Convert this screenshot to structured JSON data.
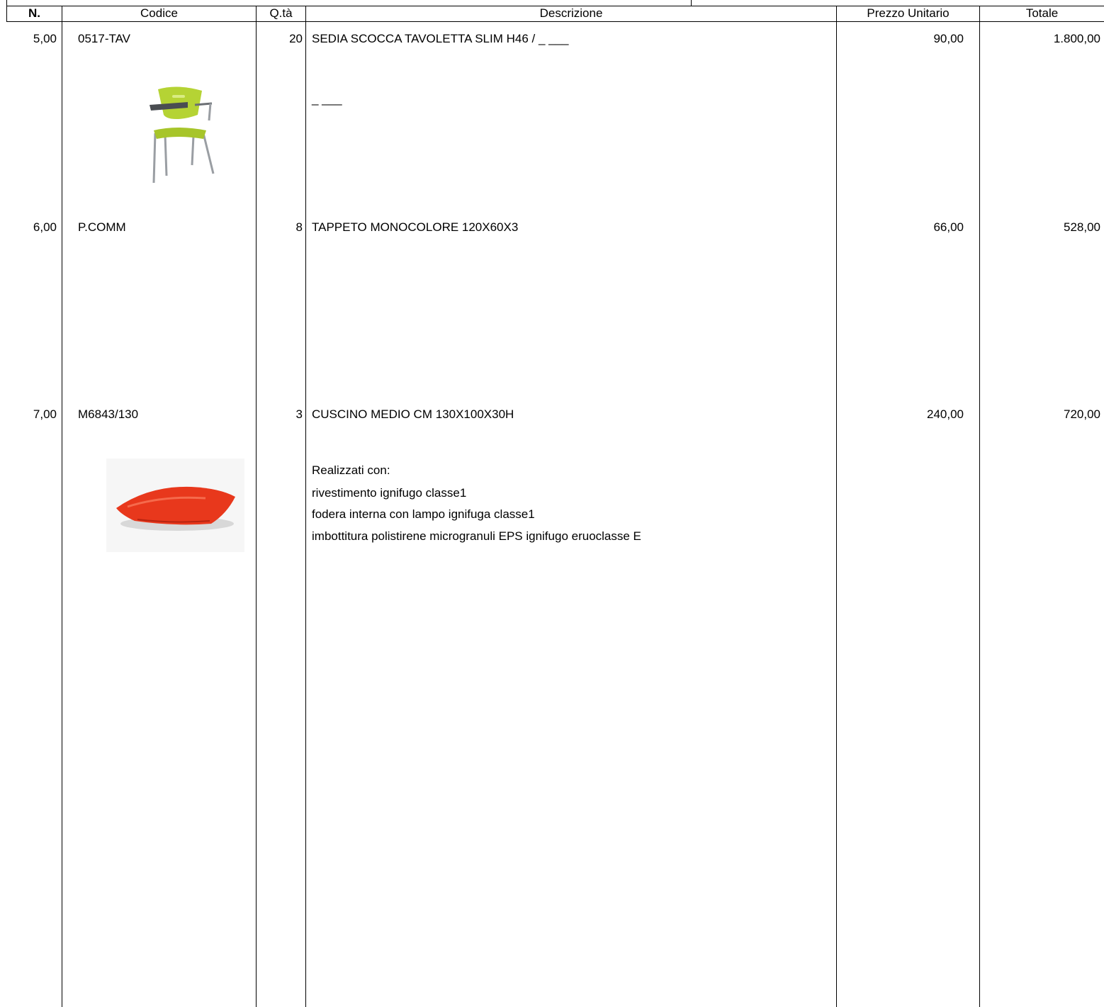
{
  "table": {
    "headers": {
      "n": "N.",
      "codice": "Codice",
      "qta": "Q.tà",
      "descrizione": "Descrizione",
      "prezzo_unitario": "Prezzo Unitario",
      "totale": "Totale"
    },
    "rows": [
      {
        "n": "5,00",
        "codice": "0517-TAV",
        "qta": "20",
        "descrizione": "SEDIA SCOCCA TAVOLETTA SLIM H46 / _ ___",
        "desc_extra": [
          "_ ___"
        ],
        "prezzo": "90,00",
        "totale": "1.800,00",
        "image": "green-chair-with-writing-tablet"
      },
      {
        "n": "6,00",
        "codice": "P.COMM",
        "qta": "8",
        "descrizione": "TAPPETO MONOCOLORE 120X60X3",
        "desc_extra": [],
        "prezzo": "66,00",
        "totale": "528,00"
      },
      {
        "n": "7,00",
        "codice": "M6843/130",
        "qta": "3",
        "descrizione": "CUSCINO MEDIO CM 130X100X30H",
        "desc_extra": [
          "Realizzati con:",
          "rivestimento ignifugo classe1",
          "fodera interna con lampo ignifuga classe1",
          "imbottitura polistirene microgranuli EPS ignifugo eruoclasse E"
        ],
        "prezzo": "240,00",
        "totale": "720,00",
        "image": "red-floor-cushion"
      }
    ]
  },
  "colors": {
    "chair_green": "#b5d334",
    "cushion_red": "#e8381c",
    "line": "#000000"
  }
}
